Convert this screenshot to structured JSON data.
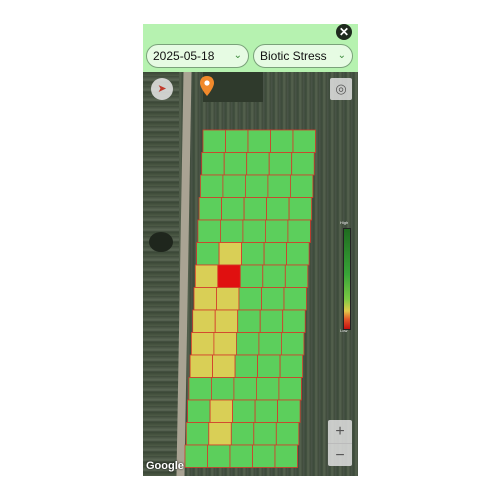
{
  "header": {
    "date_value": "2025-05-18",
    "layer_value": "Biotic Stress",
    "close_icon": "close-icon",
    "chevron_icon": "chevron-down-icon"
  },
  "map": {
    "attribution": "Google",
    "zoom_in_label": "+",
    "zoom_out_label": "−",
    "compass_icon": "compass-icon",
    "locate_icon": "locate-icon",
    "pin_icon": "map-pin-icon",
    "pin_color": "#f0892b"
  },
  "legend": {
    "top_label": "High",
    "bottom_label": "Low",
    "colors": [
      "#1f6b1f",
      "#37a437",
      "#7ac943",
      "#e2c94a",
      "#e25a2a",
      "#c41010"
    ]
  },
  "stress_grid": {
    "cell_status_colors": {
      "healthy": "#5ccf5c",
      "moderate": "#d9cf56",
      "high": "#e01010"
    },
    "rows": [
      [
        "healthy",
        "healthy",
        "healthy",
        "healthy",
        "healthy"
      ],
      [
        "healthy",
        "healthy",
        "healthy",
        "healthy",
        "healthy"
      ],
      [
        "healthy",
        "healthy",
        "healthy",
        "healthy",
        "healthy"
      ],
      [
        "healthy",
        "healthy",
        "healthy",
        "healthy",
        "healthy"
      ],
      [
        "healthy",
        "healthy",
        "healthy",
        "healthy",
        "healthy"
      ],
      [
        "healthy",
        "moderate",
        "healthy",
        "healthy",
        "healthy"
      ],
      [
        "moderate",
        "high",
        "healthy",
        "healthy",
        "healthy"
      ],
      [
        "moderate",
        "moderate",
        "healthy",
        "healthy",
        "healthy"
      ],
      [
        "moderate",
        "moderate",
        "healthy",
        "healthy",
        "healthy"
      ],
      [
        "moderate",
        "moderate",
        "healthy",
        "healthy",
        "healthy"
      ],
      [
        "moderate",
        "moderate",
        "healthy",
        "healthy",
        "healthy"
      ],
      [
        "healthy",
        "healthy",
        "healthy",
        "healthy",
        "healthy"
      ],
      [
        "healthy",
        "moderate",
        "healthy",
        "healthy",
        "healthy"
      ],
      [
        "healthy",
        "moderate",
        "healthy",
        "healthy",
        "healthy"
      ],
      [
        "healthy",
        "healthy",
        "healthy",
        "healthy",
        "healthy"
      ]
    ]
  }
}
